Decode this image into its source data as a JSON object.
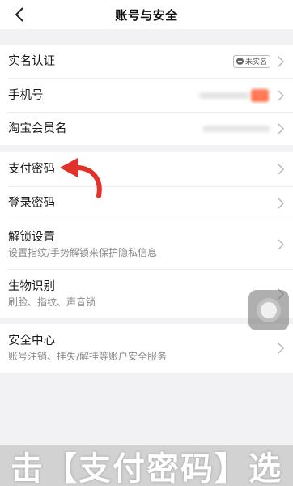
{
  "header": {
    "title": "账号与安全",
    "back_icon": "chevron-left-icon"
  },
  "group1": {
    "realname": {
      "label": "实名认证",
      "badge": "未实名"
    },
    "phone": {
      "label": "手机号"
    },
    "taobao": {
      "label": "淘宝会员名"
    }
  },
  "group2": {
    "pay_password": {
      "label": "支付密码"
    },
    "login_password": {
      "label": "登录密码"
    },
    "unlock": {
      "label": "解锁设置",
      "sub": "设置指纹/手势解锁来保护隐私信息"
    },
    "biometric": {
      "label": "生物识别",
      "sub": "刷脸、指纹、声音锁"
    }
  },
  "group3": {
    "security_center": {
      "label": "安全中心",
      "sub": "账号注销、挂失/解挂等账户安全服务"
    }
  },
  "caption": {
    "text": "击【支付密码】选"
  },
  "colors": {
    "arrow": "#e0312a",
    "background": "#f2f2f4",
    "phone_blur": "#ff7a55"
  }
}
